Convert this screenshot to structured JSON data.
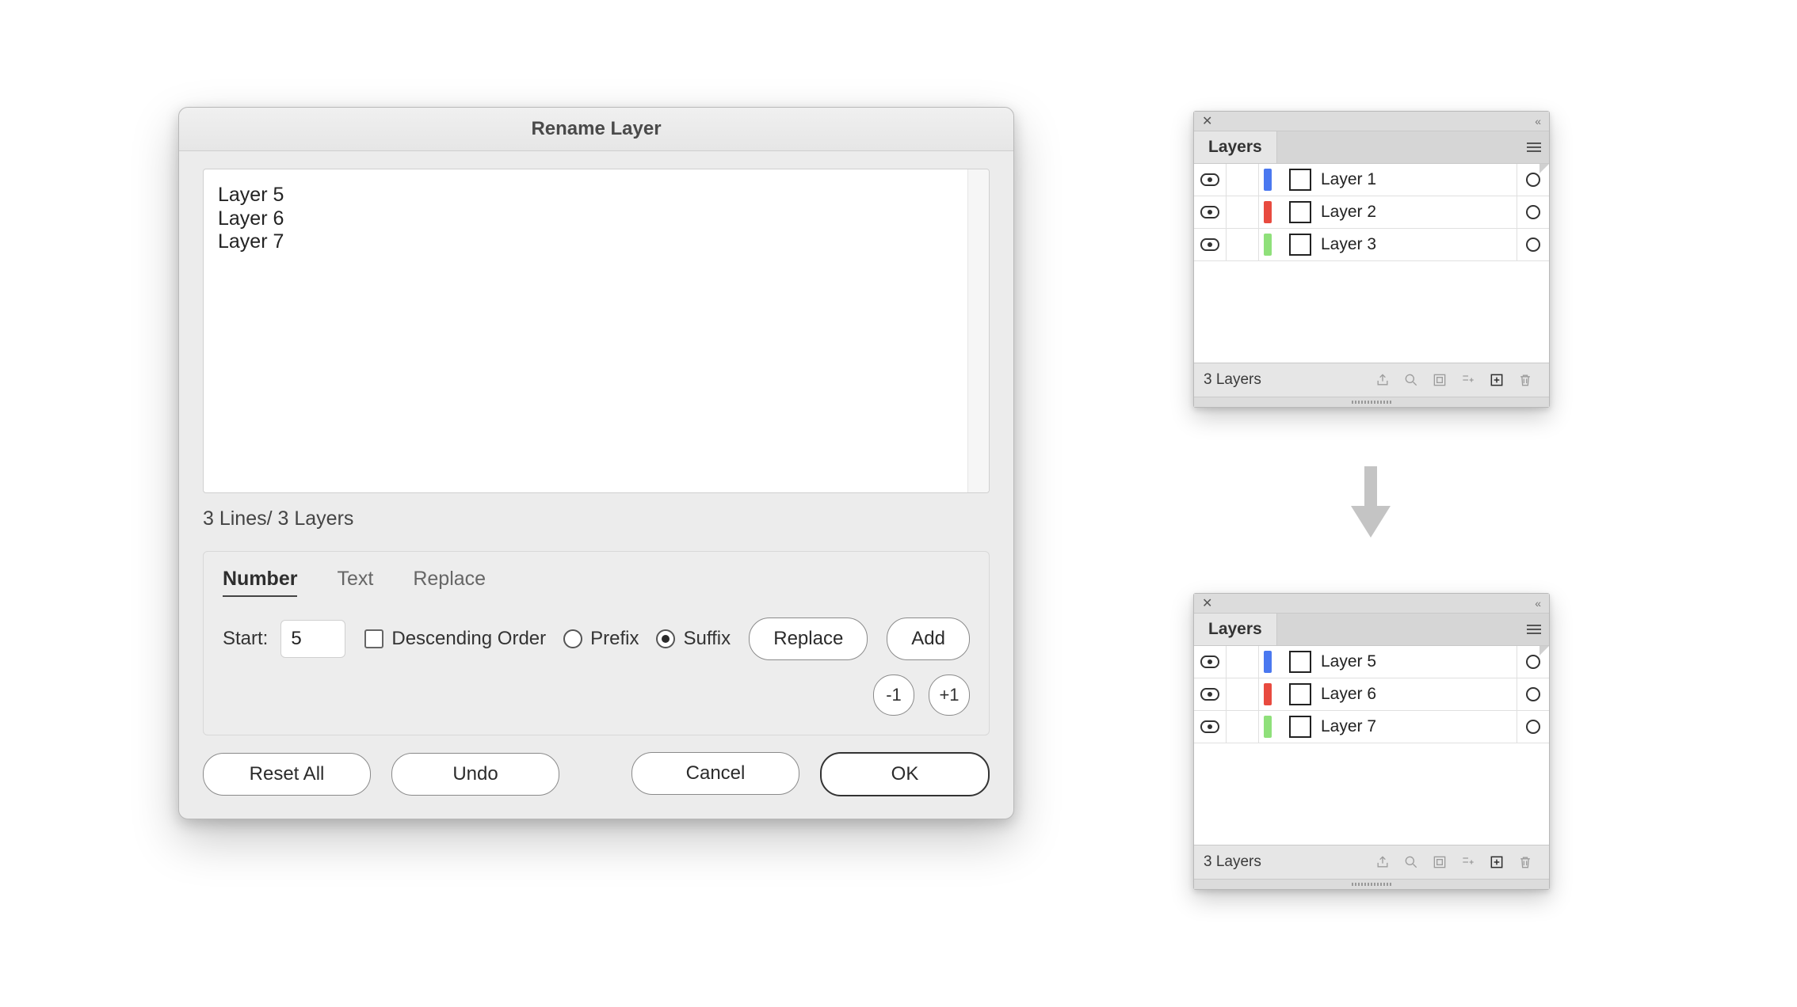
{
  "dialog": {
    "title": "Rename Layer",
    "preview_lines": [
      "Layer 5",
      "Layer 6",
      "Layer 7"
    ],
    "status": "3 Lines/ 3 Layers",
    "tabs": {
      "number": "Number",
      "text": "Text",
      "replace": "Replace",
      "active": "number"
    },
    "number_opts": {
      "start_label": "Start:",
      "start_value": "5",
      "descending_label": "Descending Order",
      "descending_checked": false,
      "prefix_label": "Prefix",
      "suffix_label": "Suffix",
      "mode": "suffix",
      "replace_btn": "Replace",
      "add_btn": "Add",
      "minus_btn": "-1",
      "plus_btn": "+1"
    },
    "footer": {
      "reset": "Reset All",
      "undo": "Undo",
      "cancel": "Cancel",
      "ok": "OK"
    }
  },
  "layers_panel": {
    "tab": "Layers",
    "footer_count": "3 Layers",
    "before": [
      {
        "name": "Layer 1",
        "color": "#4a78f0"
      },
      {
        "name": "Layer 2",
        "color": "#e84a3f"
      },
      {
        "name": "Layer 3",
        "color": "#8fe07a"
      }
    ],
    "after": [
      {
        "name": "Layer 5",
        "color": "#4a78f0"
      },
      {
        "name": "Layer 6",
        "color": "#e84a3f"
      },
      {
        "name": "Layer 7",
        "color": "#8fe07a"
      }
    ]
  }
}
